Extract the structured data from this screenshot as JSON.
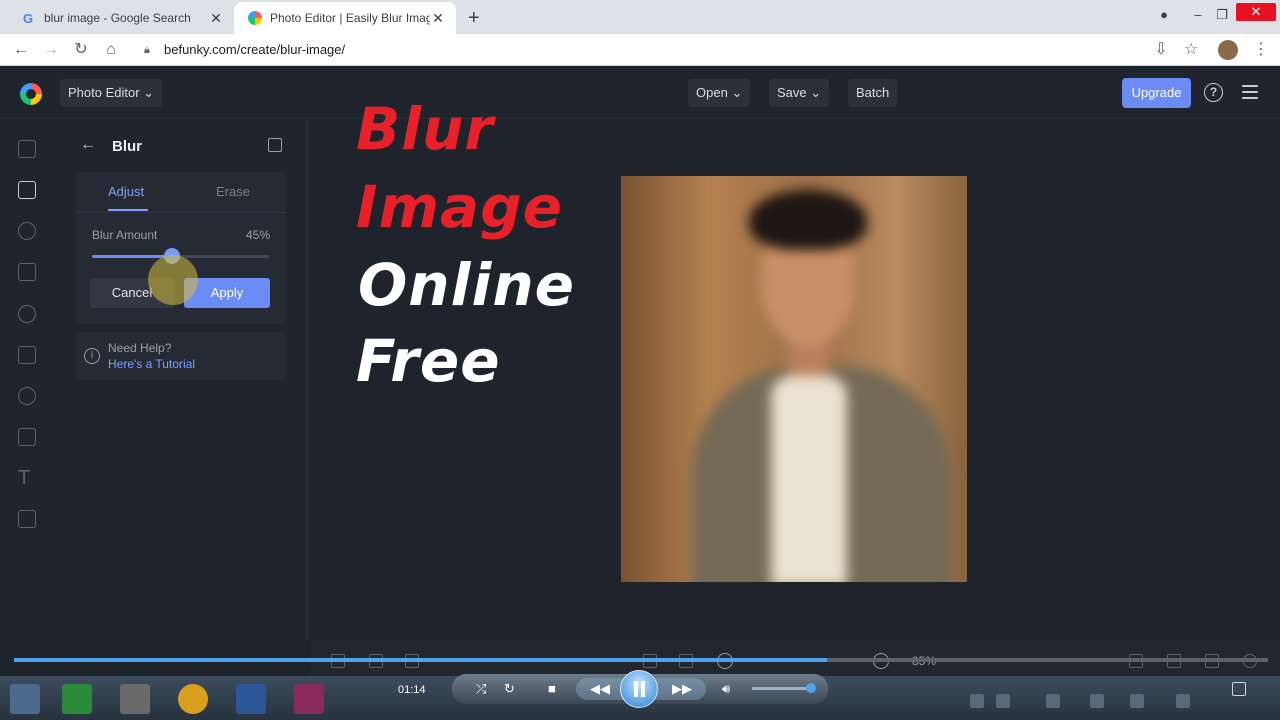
{
  "browser": {
    "tabs": [
      {
        "title": "blur image - Google Search",
        "active": false
      },
      {
        "title": "Photo Editor | Easily Blur Images",
        "active": true
      }
    ],
    "url": "befunky.com/create/blur-image/"
  },
  "header": {
    "app_menu": "Photo Editor",
    "open_label": "Open",
    "save_label": "Save",
    "batch_label": "Batch",
    "upgrade_label": "Upgrade",
    "help_glyph": "?"
  },
  "panel": {
    "title": "Blur",
    "tabs": [
      "Adjust",
      "Erase"
    ],
    "slider": {
      "label": "Blur Amount",
      "value_text": "45%",
      "value": 45
    },
    "cancel_label": "Cancel",
    "apply_label": "Apply",
    "help_question": "Need Help?",
    "help_link": "Here's a Tutorial"
  },
  "overlay": {
    "lines": [
      {
        "text": "Blur",
        "color": "#e8202a"
      },
      {
        "text": "Image",
        "color": "#e8202a"
      },
      {
        "text": "Online",
        "color": "#ffffff"
      },
      {
        "text": "Free",
        "color": "#ffffff"
      }
    ]
  },
  "editor_bottom": {
    "zoom": "85%"
  },
  "video": {
    "time": "01:14",
    "progress": 0.648
  },
  "colors": {
    "accent": "#6c8cf5",
    "app_bg": "#1f232c",
    "overlay_red": "#e8202a"
  },
  "icons": [
    "google-icon",
    "befunky-icon",
    "back-arrow-icon",
    "forward-arrow-icon",
    "reload-icon",
    "home-icon",
    "lock-icon",
    "star-icon",
    "menu-icon",
    "help-icon",
    "copy-icon",
    "info-icon",
    "play-pause-icon"
  ]
}
